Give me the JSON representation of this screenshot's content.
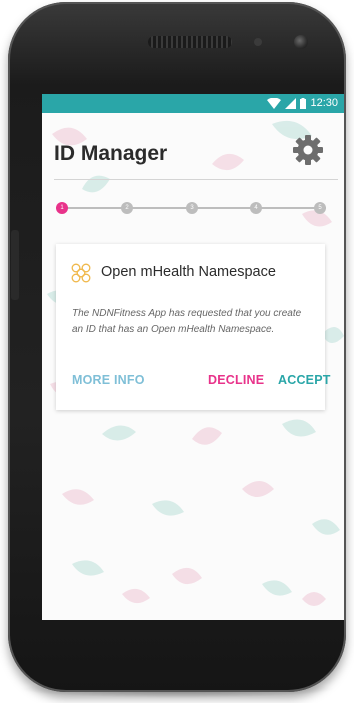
{
  "status_bar": {
    "time": "12:30",
    "icons": [
      "wifi-icon",
      "cell-signal-icon",
      "battery-icon"
    ],
    "color": "#2aa6a8"
  },
  "header": {
    "title": "ID Manager",
    "settings_icon": "gear-icon"
  },
  "stepper": {
    "steps": [
      "1",
      "2",
      "3",
      "4",
      "5"
    ],
    "active_step": 1,
    "active_color": "#e8328a",
    "inactive_color": "#bdbdbd"
  },
  "card": {
    "icon": "namespace-pattern-icon",
    "title": "Open mHealth Namespace",
    "body": "The NDNFitness App has requested that you create an ID that has an Open mHealth Namespace.",
    "actions": {
      "more_info": "MORE INFO",
      "decline": "DECLINE",
      "accept": "ACCEPT"
    }
  },
  "colors": {
    "accent_teal": "#2aa6a8",
    "accent_pink": "#e8328a",
    "link_blue": "#7fbfd7"
  }
}
